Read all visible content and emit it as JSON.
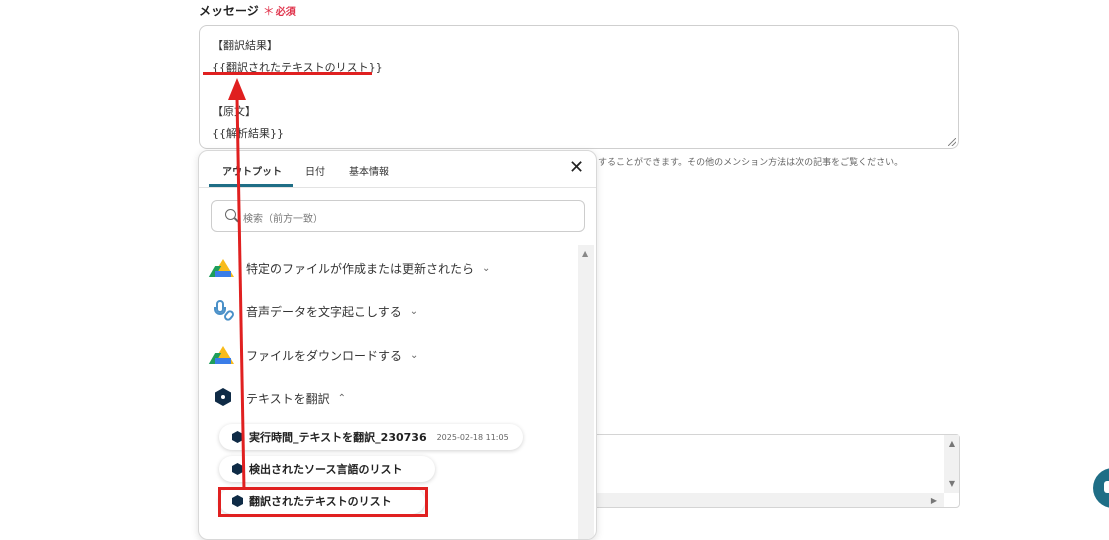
{
  "field": {
    "label": "メッセージ",
    "required_mark": "＊",
    "required_text": "必須"
  },
  "message": {
    "lines": [
      "【翻訳結果】",
      "{{翻訳されたテキストのリスト}}",
      "",
      "【原文】",
      "{{解析結果}}"
    ]
  },
  "hint": "することができます。その他のメンション方法は次の記事をご覧ください。",
  "panel": {
    "tabs": [
      "アウトプット",
      "日付",
      "基本情報"
    ],
    "active_tab": "アウトプット",
    "close_icon": "close-icon",
    "search_placeholder": "検索（前方一致）",
    "sections": [
      {
        "label": "特定のファイルが作成または更新されたら",
        "icon": "google-drive-icon",
        "expanded": false
      },
      {
        "label": "音声データを文字起こしする",
        "icon": "microphone-icon",
        "expanded": false
      },
      {
        "label": "ファイルをダウンロードする",
        "icon": "google-drive-icon",
        "expanded": false
      },
      {
        "label": "テキストを翻訳",
        "icon": "deepl-icon",
        "expanded": true
      }
    ],
    "items": [
      {
        "label": "実行時間_テキストを翻訳_230736",
        "date": "2025-02-18 11:05"
      },
      {
        "label": "検出されたソース言語のリスト",
        "date": ""
      },
      {
        "label": "翻訳されたテキストのリスト",
        "date": ""
      }
    ]
  },
  "colors": {
    "accent": "#1f6e86",
    "required": "#e0344c",
    "annotation_red": "#e02020"
  }
}
